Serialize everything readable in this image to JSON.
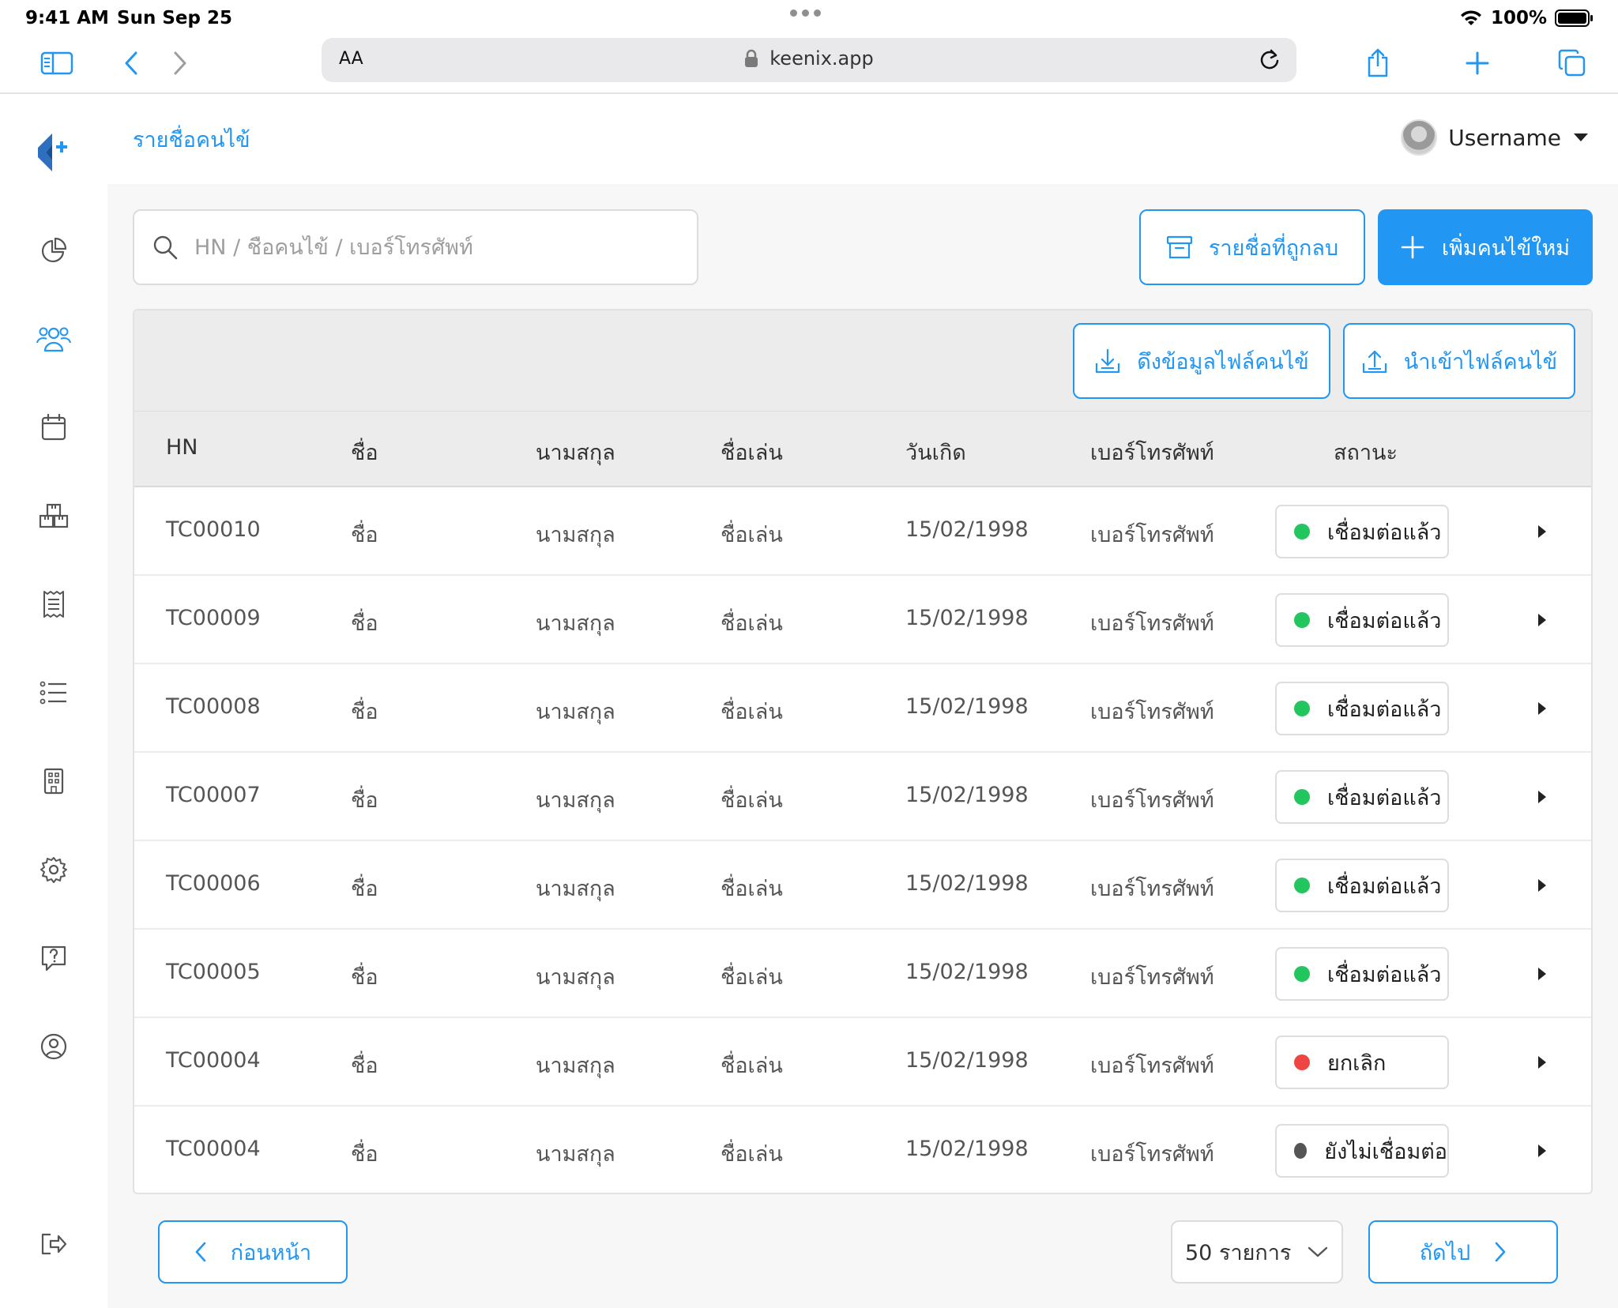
{
  "status_bar": {
    "time": "9:41 AM",
    "date": "Sun Sep 25",
    "battery": "100%"
  },
  "browser": {
    "text_size_label": "AA",
    "url": "keenix.app",
    "icons": [
      "sidebar-icon",
      "back-icon",
      "forward-icon",
      "lock-icon",
      "reload-icon",
      "share-icon",
      "new-tab-icon",
      "tabs-icon"
    ]
  },
  "sidebar": {
    "logo": "keenix-logo",
    "items": [
      "dashboard-chart-icon",
      "patients-icon",
      "calendar-icon",
      "inventory-icon",
      "receipt-icon",
      "list-icon",
      "building-icon",
      "settings-icon",
      "help-icon",
      "account-icon",
      "logout-icon"
    ]
  },
  "header": {
    "title": "รายชื่อคนไข้",
    "username": "Username"
  },
  "search": {
    "placeholder": "HN / ชื่อคนไข้ / เบอร์โทรศัพท์"
  },
  "actions": {
    "deleted_list": "รายชื่อที่ถูกลบ",
    "add_patient": "เพิ่มคนไข้ใหม่",
    "export_file": "ดึงข้อมูลไฟล์คนไข้",
    "import_file": "นำเข้าไฟล์คนไข้"
  },
  "table": {
    "headers": {
      "hn": "HN",
      "first_name": "ชื่อ",
      "last_name": "นามสกุล",
      "nickname": "ชื่อเล่น",
      "birthdate": "วันเกิด",
      "phone": "เบอร์โทรศัพท์",
      "status": "สถานะ"
    },
    "rows": [
      {
        "hn": "TC00010",
        "first_name": "ชื่อ",
        "last_name": "นามสกุล",
        "nickname": "ชื่อเล่น",
        "birthdate": "15/02/1998",
        "phone": "เบอร์โทรศัพท์",
        "status": "เชื่อมต่อแล้ว",
        "status_color": "#22c55e"
      },
      {
        "hn": "TC00009",
        "first_name": "ชื่อ",
        "last_name": "นามสกุล",
        "nickname": "ชื่อเล่น",
        "birthdate": "15/02/1998",
        "phone": "เบอร์โทรศัพท์",
        "status": "เชื่อมต่อแล้ว",
        "status_color": "#22c55e"
      },
      {
        "hn": "TC00008",
        "first_name": "ชื่อ",
        "last_name": "นามสกุล",
        "nickname": "ชื่อเล่น",
        "birthdate": "15/02/1998",
        "phone": "เบอร์โทรศัพท์",
        "status": "เชื่อมต่อแล้ว",
        "status_color": "#22c55e"
      },
      {
        "hn": "TC00007",
        "first_name": "ชื่อ",
        "last_name": "นามสกุล",
        "nickname": "ชื่อเล่น",
        "birthdate": "15/02/1998",
        "phone": "เบอร์โทรศัพท์",
        "status": "เชื่อมต่อแล้ว",
        "status_color": "#22c55e"
      },
      {
        "hn": "TC00006",
        "first_name": "ชื่อ",
        "last_name": "นามสกุล",
        "nickname": "ชื่อเล่น",
        "birthdate": "15/02/1998",
        "phone": "เบอร์โทรศัพท์",
        "status": "เชื่อมต่อแล้ว",
        "status_color": "#22c55e"
      },
      {
        "hn": "TC00005",
        "first_name": "ชื่อ",
        "last_name": "นามสกุล",
        "nickname": "ชื่อเล่น",
        "birthdate": "15/02/1998",
        "phone": "เบอร์โทรศัพท์",
        "status": "เชื่อมต่อแล้ว",
        "status_color": "#22c55e"
      },
      {
        "hn": "TC00004",
        "first_name": "ชื่อ",
        "last_name": "นามสกุล",
        "nickname": "ชื่อเล่น",
        "birthdate": "15/02/1998",
        "phone": "เบอร์โทรศัพท์",
        "status": "ยกเลิก",
        "status_color": "#ef4444"
      },
      {
        "hn": "TC00004",
        "first_name": "ชื่อ",
        "last_name": "นามสกุล",
        "nickname": "ชื่อเล่น",
        "birthdate": "15/02/1998",
        "phone": "เบอร์โทรศัพท์",
        "status": "ยังไม่เชื่อมต่อ",
        "status_color": "#555555"
      }
    ]
  },
  "pagination": {
    "prev": "ก่อนหน้า",
    "per_page": "50 รายการ",
    "next": "ถัดไป"
  },
  "colors": {
    "accent": "#2196f3",
    "connected": "#22c55e",
    "cancelled": "#ef4444",
    "not_connected": "#555555"
  }
}
